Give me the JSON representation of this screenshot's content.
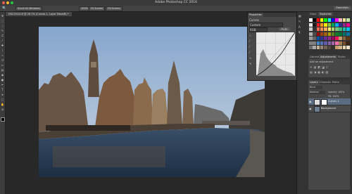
{
  "window": {
    "title": "Adobe Photoshop CC 2016",
    "traffic_lights": [
      "#f25f57",
      "#f8bd2e",
      "#2ac840"
    ]
  },
  "options_bar": {
    "buttons": [
      "Scroll All Windows",
      "100%",
      "Fit Screen",
      "Fill Screen"
    ],
    "workspace": "Essentials"
  },
  "document": {
    "tab_title": "DSC2514.tif @ 26.7% (Curves 1, Layer Mask/8) *"
  },
  "properties_panel": {
    "tab": "Properties",
    "subtitle": "Curves",
    "preset": "Custom",
    "channel": "RGB",
    "auto_label": "Auto"
  },
  "swatches_panel": {
    "tabs": [
      "Color",
      "Swatches"
    ],
    "colors": [
      "#ffffff",
      "#000000",
      "#ff0000",
      "#ffff00",
      "#00ff00",
      "#00ffff",
      "#0000ff",
      "#ff00ff",
      "#f7b8b8",
      "#fbe59a",
      "#bfe6a1",
      "#e6e6e6",
      "#1a1a1a",
      "#ed1c24",
      "#f7941d",
      "#fff200",
      "#8dc63f",
      "#00a651",
      "#00aeef",
      "#2e3192",
      "#92278f",
      "#ec008c",
      "#cccccc",
      "#333333",
      "#f26c4f",
      "#f68e55",
      "#fbaf5c",
      "#fff467",
      "#acd372",
      "#7cc576",
      "#3bb878",
      "#1abbb4",
      "#00bff3",
      "#b3b3b3",
      "#4d4d4d",
      "#9e0b0f",
      "#a0410d",
      "#a3620a",
      "#aba000",
      "#598527",
      "#1a7b30",
      "#007236",
      "#00746b",
      "#0076a3",
      "#999999",
      "#666666",
      "#0054a6",
      "#2e3192",
      "#662d91",
      "#92278f",
      "#9e005d",
      "#ed145b",
      "#c69c6d",
      "#8c6239",
      "#603913",
      "#808080",
      "#7f7f7f",
      "#448ccb",
      "#5674b9",
      "#605ca8",
      "#855fa8",
      "#a864a8",
      "#f06eaa",
      "#a67c52",
      "#754c24",
      "#3b2314",
      "#6d6d6d",
      "#a9a9a9",
      "#c7b299",
      "#998675",
      "#736357",
      "#534741",
      "#37302a",
      "#c69c6d",
      "#d2b48c",
      "#e8d4b0",
      "#f0e0c8"
    ]
  },
  "adjustments_panel": {
    "tabs": [
      "Libraries",
      "Adjustments",
      "Styles"
    ],
    "add_label": "Add an adjustment"
  },
  "layers_panel": {
    "tabs": [
      "Layers",
      "Channels",
      "Paths"
    ],
    "kind_label": "Kind",
    "mode": "Normal",
    "opacity_label": "Opacity: 100%",
    "fill_label": "Fill: 100%",
    "layers": [
      {
        "name": "Curves 1",
        "selected": true
      },
      {
        "name": "Background",
        "selected": false
      }
    ]
  }
}
